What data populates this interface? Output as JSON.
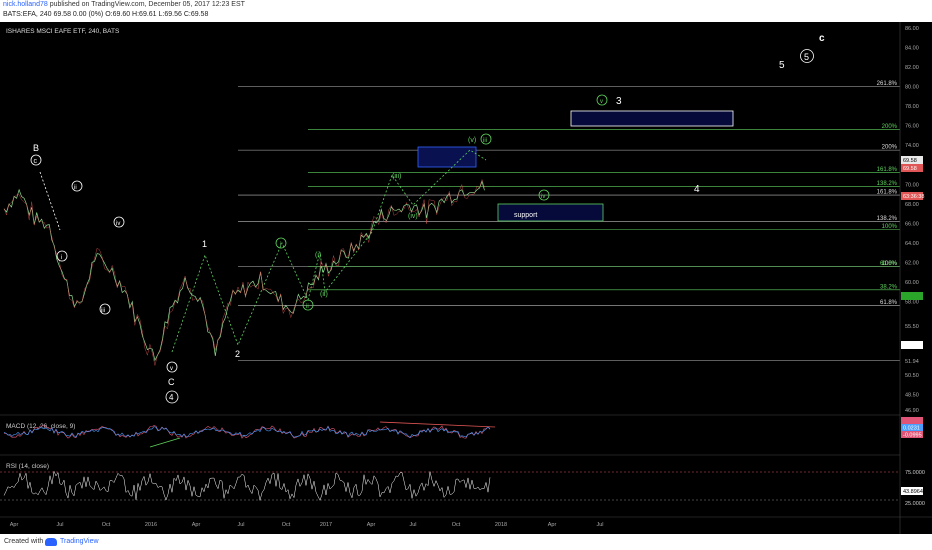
{
  "header": {
    "user": "nick.holland78",
    "published": " published on TradingView.com, December 05, 2017 12:23 EST",
    "ticker_line": "BATS:EFA, 240  69.58 0.00 (0%)  O:69.60 H:69.61 L:69.56 C:69.58"
  },
  "footer": {
    "created_with": "Created with",
    "brand": "TradingView"
  },
  "chart_data": {
    "type": "line",
    "title": "ISHARES MSCI EAFE ETF, 240, BATS",
    "price_axis": [
      "86.00",
      "84.00",
      "82.00",
      "80.00",
      "78.00",
      "76.00",
      "74.00",
      "72.00",
      "70.00",
      "68.00",
      "66.00",
      "64.00",
      "62.00",
      "60.00",
      "58.00",
      "55.50",
      "53.50",
      "51.94",
      "50.50",
      "48.50",
      "46.90"
    ],
    "time_axis": [
      "Apr",
      "Jul",
      "Oct",
      "2016",
      "Apr",
      "Jul",
      "Oct",
      "2017",
      "Apr",
      "Jul",
      "Oct",
      "2018",
      "Apr",
      "Jul"
    ],
    "last_price_labels": [
      "69.58",
      "69.58",
      "63:36:38"
    ],
    "fib_levels": [
      {
        "label": "261.8%",
        "price": 80.0,
        "color": "#bbbbbb"
      },
      {
        "label": "200%",
        "price": 75.6,
        "color": "#5fd35f"
      },
      {
        "label": "200%",
        "price": 73.5,
        "color": "#bbbbbb"
      },
      {
        "label": "161.8%",
        "price": 71.2,
        "color": "#5fd35f"
      },
      {
        "label": "138.2%",
        "price": 69.8,
        "color": "#5fd35f"
      },
      {
        "label": "161.8%",
        "price": 68.9,
        "color": "#bbbbbb"
      },
      {
        "label": "138.2%",
        "price": 66.2,
        "color": "#bbbbbb"
      },
      {
        "label": "100%",
        "price": 65.4,
        "color": "#5fd35f"
      },
      {
        "label": "100%",
        "price": 61.6,
        "color": "#bbbbbb"
      },
      {
        "label": "61.8%",
        "price": 61.6,
        "color": "#5fd35f"
      },
      {
        "label": "38.2%",
        "price": 59.2,
        "color": "#5fd35f"
      },
      {
        "label": "61.8%",
        "price": 57.6,
        "color": "#bbbbbb"
      },
      {
        "label": "",
        "price": 51.94,
        "color": "#bbbbbb"
      }
    ],
    "support_label": "support",
    "wave_labels": {
      "white": [
        "B",
        "c",
        "ii",
        "i",
        "iii",
        "iv",
        "v",
        "C",
        "4",
        "1",
        "2",
        "3",
        "4",
        "5",
        "5",
        "c"
      ],
      "green": [
        "i",
        "ii",
        "(i)",
        "(ii)",
        "(iii)",
        "(iv)",
        "(v)",
        "iii",
        "iv",
        "v"
      ]
    },
    "indicators": [
      {
        "name": "MACD (12, 26, close, 9)",
        "values": [
          "0.0231",
          "-0.0995"
        ]
      },
      {
        "name": "RSI (14, close)",
        "values": [
          "75.0000",
          "43.8964",
          "25.0000"
        ]
      }
    ],
    "series": [
      {
        "name": "EFA",
        "x": [
          "2015-04",
          "2015-05",
          "2015-06",
          "2015-07",
          "2015-08",
          "2015-09",
          "2015-10",
          "2015-11",
          "2015-12",
          "2016-01",
          "2016-02",
          "2016-03",
          "2016-04",
          "2016-05",
          "2016-06",
          "2016-07",
          "2016-08",
          "2016-09",
          "2016-10",
          "2016-11",
          "2016-12",
          "2017-01",
          "2017-02",
          "2017-03",
          "2017-04",
          "2017-05",
          "2017-06",
          "2017-07",
          "2017-08",
          "2017-09",
          "2017-10",
          "2017-11",
          "2017-12"
        ],
        "values": [
          67.5,
          69.2,
          66.5,
          65.8,
          60.2,
          57.2,
          62.5,
          61.5,
          59.2,
          55.5,
          52.0,
          57.2,
          60.1,
          58.5,
          52.5,
          58.2,
          59.3,
          60.3,
          58.5,
          57.2,
          59.0,
          61.0,
          62.2,
          63.2,
          64.8,
          66.8,
          67.4,
          68.0,
          67.1,
          68.3,
          69.2,
          69.8,
          69.58
        ]
      }
    ]
  }
}
